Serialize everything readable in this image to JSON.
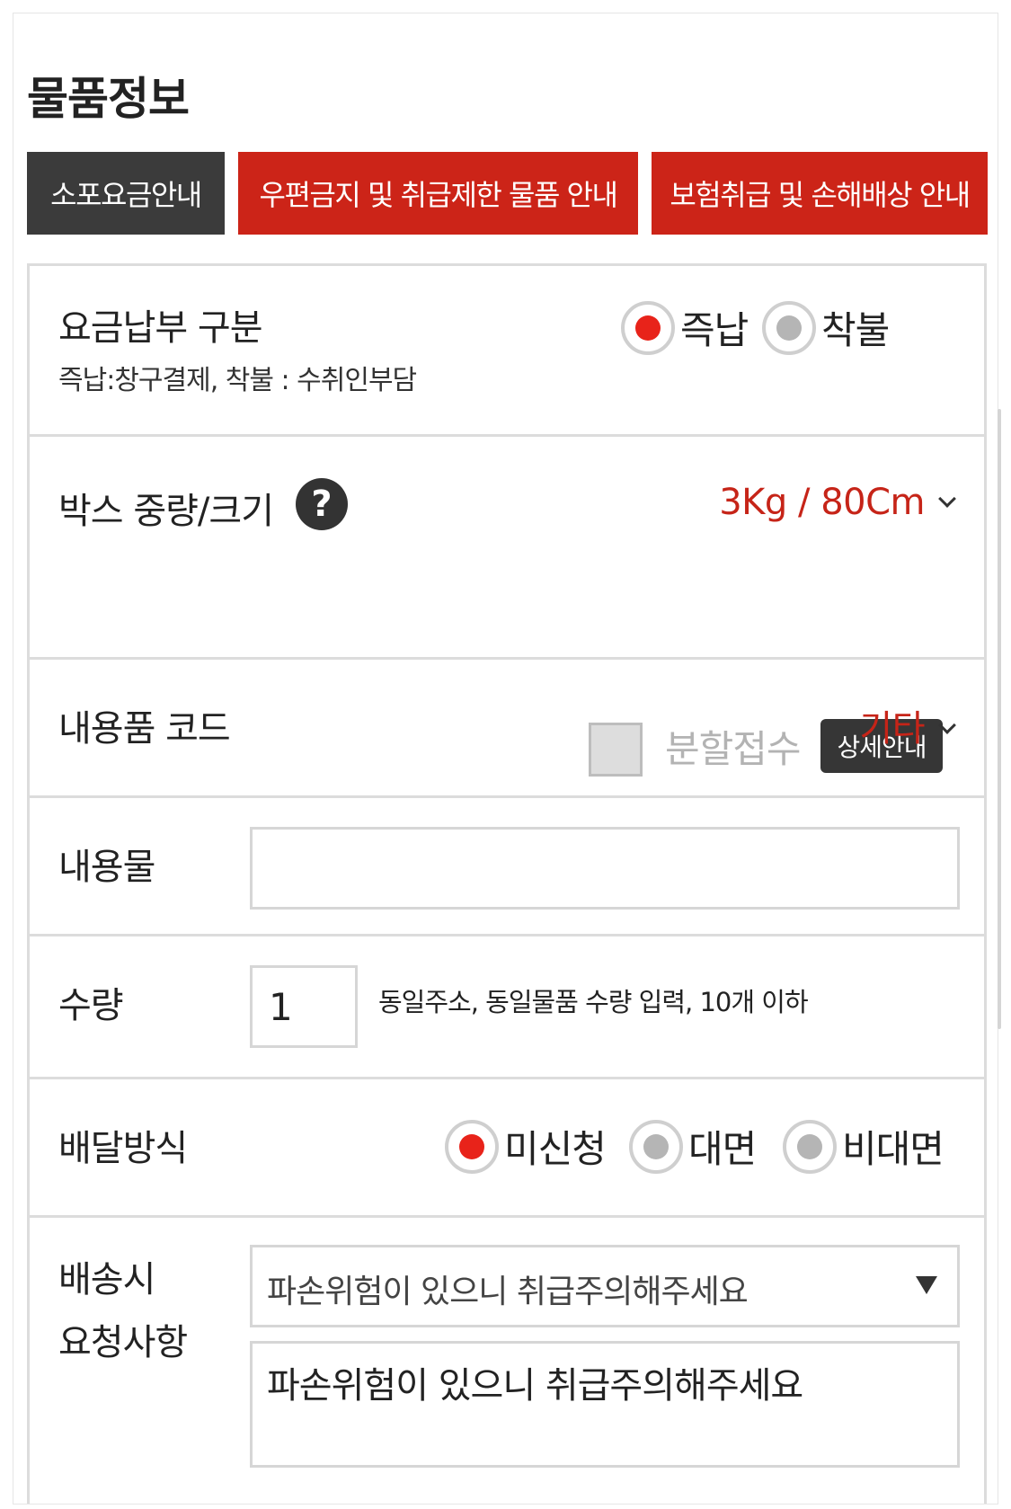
{
  "section_title": "물품정보",
  "tabs": {
    "fee_guide": "소포요금안내",
    "prohibited_guide": "우편금지 및 취급제한 물품 안내",
    "insurance_guide": "보험취급 및 손해배상 안내"
  },
  "payment": {
    "label": "요금납부 구분",
    "sublabel": "즉납:창구결제, 착불 : 수취인부담",
    "options": [
      "즉납",
      "착불"
    ],
    "selected": "즉납"
  },
  "box": {
    "label": "박스 중량/크기",
    "help_icon": "question-mark",
    "value": "3Kg / 80Cm",
    "split_label": "분할접수",
    "split_checked": false,
    "detail_button": "상세안내"
  },
  "content_code": {
    "label": "내용품 코드",
    "value": "기타"
  },
  "contents": {
    "label": "내용물",
    "value": ""
  },
  "quantity": {
    "label": "수량",
    "value": "1",
    "hint": "동일주소, 동일물품 수량 입력, 10개 이하"
  },
  "delivery": {
    "label": "배달방식",
    "options": [
      "미신청",
      "대면",
      "비대면"
    ],
    "selected": "미신청"
  },
  "request": {
    "label_line1": "배송시",
    "label_line2": "요청사항",
    "select_value": "파손위험이 있으니 취급주의해주세요",
    "textarea_value": "파손위험이 있으니 취급주의해주세요"
  },
  "colors": {
    "accent_red": "#cc2418",
    "dark_button": "#3b3b3b",
    "radio_selected": "#e8231a",
    "radio_unselected": "#b5b5b5"
  }
}
